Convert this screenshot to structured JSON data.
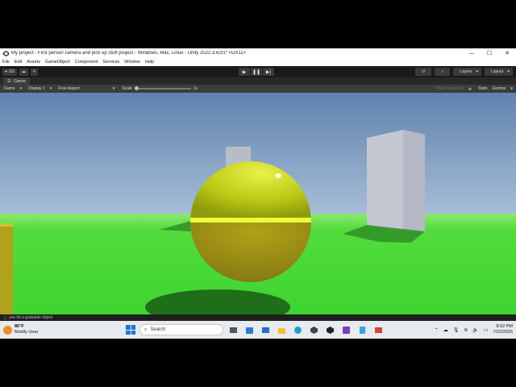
{
  "window": {
    "title": "My project - First person camera and pick up stuff project - Windows, Mac, Linux - Unity 2022.3.62f1* <DX11>",
    "controls": [
      "—",
      "☐",
      "✕"
    ]
  },
  "menu": [
    "File",
    "Edit",
    "Assets",
    "GameObject",
    "Component",
    "Services",
    "Window",
    "Help"
  ],
  "toolbar": {
    "account_label": "SS",
    "layers_label": "Layers",
    "layout_label": "Layout"
  },
  "tab": {
    "label": "Game"
  },
  "game_bar": {
    "mode": "Game",
    "display": "Display 1",
    "aspect": "Free Aspect",
    "scale_label": "Scale",
    "scale_value": "1x",
    "play_focused": "Play Focused",
    "stats": "Stats",
    "gizmos": "Gizmos"
  },
  "status": {
    "message": "you hit a grabable object"
  },
  "taskbar": {
    "weather_temp": "86°F",
    "weather_desc": "Mostly clear",
    "search_placeholder": "Search",
    "time": "8:52 PM",
    "date": "7/22/2026"
  },
  "colors": {
    "sky_top": "#5f82ad",
    "sky_horizon": "#dfe8f2",
    "ground": "#46d93a",
    "sphere": "#c8d81a",
    "accent": "#46607c"
  }
}
